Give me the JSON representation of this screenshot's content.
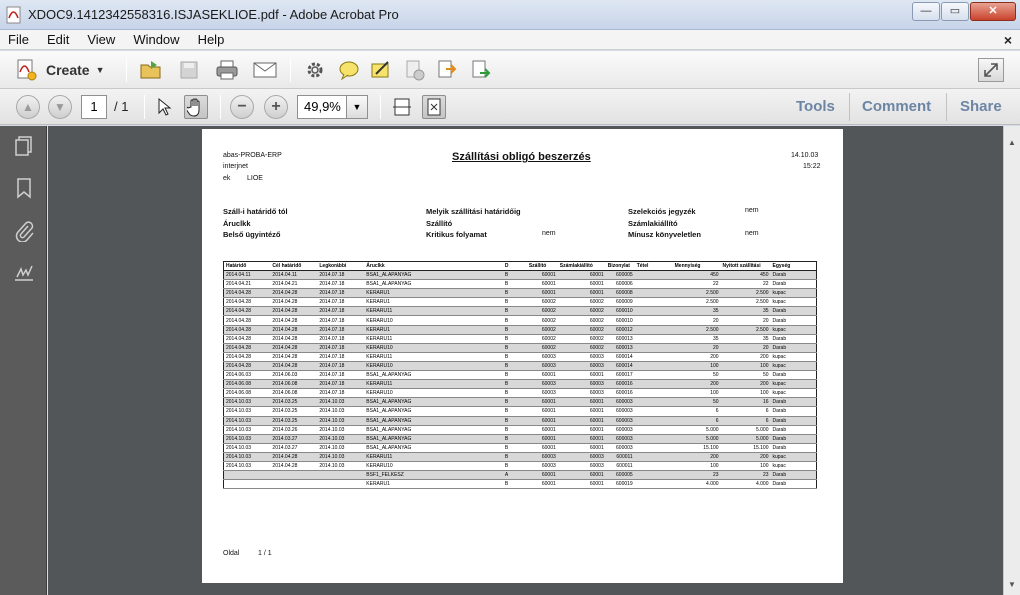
{
  "window": {
    "title": "XDOC9.1412342558316.ISJASEKLIOE.pdf - Adobe Acrobat Pro",
    "minimize": "—",
    "maximize": "▭",
    "close": "✕"
  },
  "menu": {
    "items": [
      "File",
      "Edit",
      "View",
      "Window",
      "Help"
    ],
    "close_doc": "×"
  },
  "toolbar": {
    "create_label": "Create"
  },
  "nav": {
    "current_page": "1",
    "total_pages": "/ 1",
    "zoom": "49,9%",
    "tools": "Tools",
    "comment": "Comment",
    "share": "Share"
  },
  "doc": {
    "company": "abas-PROBA-ERP",
    "line2": "interjnet",
    "line3a": "ek",
    "line3b": "LIOE",
    "title": "Szállítási obligó beszerzés",
    "date": "14.10.03",
    "time": "15:22",
    "filters": {
      "szall_hat": "Száll-i határidő tól",
      "aruclk": "Áruclkk",
      "belso": "Belső ügyintéző",
      "melyik": "Melyik szállítási határidőig",
      "szallito": "Szállító",
      "kritikus": "Kritikus folyamat",
      "kritikus_val": "nem",
      "szelekcios": "Szelekciós jegyzék",
      "szelekcios_val": "nem",
      "szamlakiallito": "Számlakiállító",
      "minusz": "Mínusz könyveletlen",
      "minusz_val": "nem"
    },
    "table_headers": [
      "Határidő",
      "Cél határidő",
      "Legkorábbi",
      "Áruclkk",
      "D",
      "Szállító",
      "Számlakiállító",
      "Bizonylat",
      "Tétel",
      "Mennyiség",
      "Nyitott szállítási",
      "Egység"
    ],
    "rows": [
      [
        "2014.04.11",
        "2014.04.11",
        "2014.07.18",
        "BSA1_ALAPANYAG",
        "B",
        "60001",
        "60001",
        "600005",
        "",
        "450",
        "450",
        "Darab"
      ],
      [
        "2014.04.21",
        "2014.04.21",
        "2014.07.18",
        "BSA1_ALAPANYAG",
        "B",
        "60001",
        "60001",
        "600006",
        "",
        "22",
        "22",
        "Darab"
      ],
      [
        "2014.04.28",
        "2014.04.28",
        "2014.07.18",
        "KERARU1",
        "B",
        "60001",
        "60001",
        "600008",
        "",
        "2.500",
        "2.500",
        "kupac"
      ],
      [
        "2014.04.28",
        "2014.04.28",
        "2014.07.18",
        "KERARU1",
        "B",
        "60002",
        "60002",
        "600009",
        "",
        "2.500",
        "2.500",
        "kupac"
      ],
      [
        "2014.04.28",
        "2014.04.28",
        "2014.07.18",
        "KERARU11",
        "B",
        "60002",
        "60002",
        "600010",
        "",
        "35",
        "35",
        "Darab"
      ],
      [
        "2014.04.28",
        "2014.04.28",
        "2014.07.18",
        "KERARU10",
        "B",
        "60002",
        "60002",
        "600010",
        "",
        "20",
        "20",
        "Darab"
      ],
      [
        "2014.04.28",
        "2014.04.28",
        "2014.07.18",
        "KERARU1",
        "B",
        "60002",
        "60002",
        "600012",
        "",
        "2.500",
        "2.500",
        "kupac"
      ],
      [
        "2014.04.28",
        "2014.04.28",
        "2014.07.18",
        "KERARU11",
        "B",
        "60002",
        "60002",
        "600013",
        "",
        "35",
        "35",
        "Darab"
      ],
      [
        "2014.04.28",
        "2014.04.28",
        "2014.07.18",
        "KERARU10",
        "B",
        "60002",
        "60002",
        "600013",
        "",
        "20",
        "20",
        "Darab"
      ],
      [
        "2014.04.28",
        "2014.04.28",
        "2014.07.18",
        "KERARU11",
        "B",
        "60003",
        "60003",
        "600014",
        "",
        "200",
        "200",
        "kupac"
      ],
      [
        "2014.04.28",
        "2014.04.28",
        "2014.07.18",
        "KERARU10",
        "B",
        "60003",
        "60003",
        "600014",
        "",
        "100",
        "100",
        "kupac"
      ],
      [
        "2014.06.03",
        "2014.06.03",
        "2014.07.18",
        "BSA1_ALAPANYAG",
        "B",
        "60001",
        "60001",
        "600017",
        "",
        "50",
        "50",
        "Darab"
      ],
      [
        "2014.06.08",
        "2014.06.08",
        "2014.07.18",
        "KERARU11",
        "B",
        "60003",
        "60003",
        "600016",
        "",
        "200",
        "200",
        "kupac"
      ],
      [
        "2014.06.08",
        "2014.06.08",
        "2014.07.18",
        "KERARU10",
        "B",
        "60003",
        "60003",
        "600016",
        "",
        "100",
        "100",
        "kupac"
      ],
      [
        "2014.10.03",
        "2014.03.25",
        "2014.10.03",
        "BSA1_ALAPANYAG",
        "B",
        "60001",
        "60001",
        "600003",
        "",
        "50",
        "16",
        "Darab"
      ],
      [
        "2014.10.03",
        "2014.03.25",
        "2014.10.03",
        "BSA1_ALAPANYAG",
        "B",
        "60001",
        "60001",
        "600003",
        "",
        "6",
        "6",
        "Darab"
      ],
      [
        "2014.10.03",
        "2014.03.25",
        "2014.10.03",
        "BSA1_ALAPANYAG",
        "B",
        "60001",
        "60001",
        "600003",
        "",
        "6",
        "6",
        "Darab"
      ],
      [
        "2014.10.03",
        "2014.03.26",
        "2014.10.03",
        "BSA1_ALAPANYAG",
        "B",
        "60001",
        "60001",
        "600003",
        "",
        "5.000",
        "5.000",
        "Darab"
      ],
      [
        "2014.10.03",
        "2014.03.27",
        "2014.10.03",
        "BSA1_ALAPANYAG",
        "B",
        "60001",
        "60001",
        "600003",
        "",
        "5.000",
        "5.000",
        "Darab"
      ],
      [
        "2014.10.03",
        "2014.03.27",
        "2014.10.03",
        "BSA1_ALAPANYAG",
        "B",
        "60001",
        "60001",
        "600003",
        "",
        "15.100",
        "15.100",
        "Darab"
      ],
      [
        "2014.10.03",
        "2014.04.28",
        "2014.10.03",
        "KERARU11",
        "B",
        "60003",
        "60003",
        "600011",
        "",
        "200",
        "200",
        "kupac"
      ],
      [
        "2014.10.03",
        "2014.04.28",
        "2014.10.03",
        "KERARU10",
        "B",
        "60003",
        "60003",
        "600011",
        "",
        "100",
        "100",
        "kupac"
      ],
      [
        "",
        "",
        "",
        "BSF1_FELKESZ",
        "A",
        "60001",
        "60001",
        "600005",
        "",
        "23",
        "23",
        "Darab"
      ],
      [
        "",
        "",
        "",
        "KERARU1",
        "B",
        "60001",
        "60001",
        "600019",
        "",
        "4.000",
        "4.000",
        "Darab"
      ]
    ],
    "footer_label": "Oldal",
    "footer_value": "1 / 1"
  }
}
